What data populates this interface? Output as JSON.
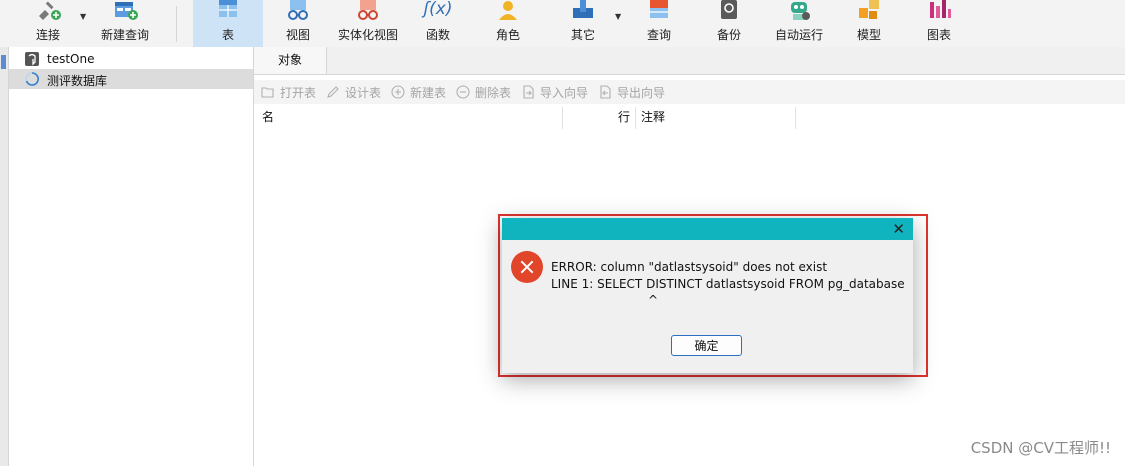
{
  "toolbar": {
    "items": [
      {
        "label": "连接",
        "icon": "plug-icon"
      },
      {
        "label": "新建查询",
        "icon": "new-query-icon"
      },
      {
        "label": "表",
        "icon": "table-icon"
      },
      {
        "label": "视图",
        "icon": "view-icon"
      },
      {
        "label": "实体化视图",
        "icon": "materialized-view-icon"
      },
      {
        "label": "函数",
        "icon": "function-icon"
      },
      {
        "label": "角色",
        "icon": "role-icon"
      },
      {
        "label": "其它",
        "icon": "other-icon"
      },
      {
        "label": "查询",
        "icon": "query-icon"
      },
      {
        "label": "备份",
        "icon": "backup-icon"
      },
      {
        "label": "自动运行",
        "icon": "robot-icon"
      },
      {
        "label": "模型",
        "icon": "model-icon"
      },
      {
        "label": "图表",
        "icon": "chart-icon"
      }
    ],
    "active": "表",
    "function_glyph": "ʃ(x)"
  },
  "tree": {
    "items": [
      {
        "label": "testOne",
        "icon": "postgres-connection-icon"
      },
      {
        "label": "测评数据库",
        "icon": "database-loading-icon"
      }
    ]
  },
  "tabs": [
    {
      "label": "对象"
    }
  ],
  "object_toolbar": [
    {
      "label": "打开表",
      "icon": "folder-open-icon"
    },
    {
      "label": "设计表",
      "icon": "pencil-icon"
    },
    {
      "label": "新建表",
      "icon": "plus-circle-icon"
    },
    {
      "label": "删除表",
      "icon": "minus-circle-icon"
    },
    {
      "label": "导入向导",
      "icon": "import-icon"
    },
    {
      "label": "导出向导",
      "icon": "export-icon"
    }
  ],
  "columns": [
    {
      "label": "名"
    },
    {
      "label": "行"
    },
    {
      "label": "注释"
    }
  ],
  "dialog": {
    "line1": "ERROR:  column \"datlastsysoid\" does not exist",
    "line2": "LINE 1: SELECT DISTINCT datlastsysoid FROM pg_database",
    "line3": "^",
    "ok_label": "确定",
    "close_glyph": "✕"
  },
  "watermark": "CSDN @CV工程师!!",
  "colors": {
    "dialog_title": "#10b4be",
    "error": "#e2462a",
    "highlight_outline": "#e0332e",
    "active_tab": "#cfe3f7"
  }
}
